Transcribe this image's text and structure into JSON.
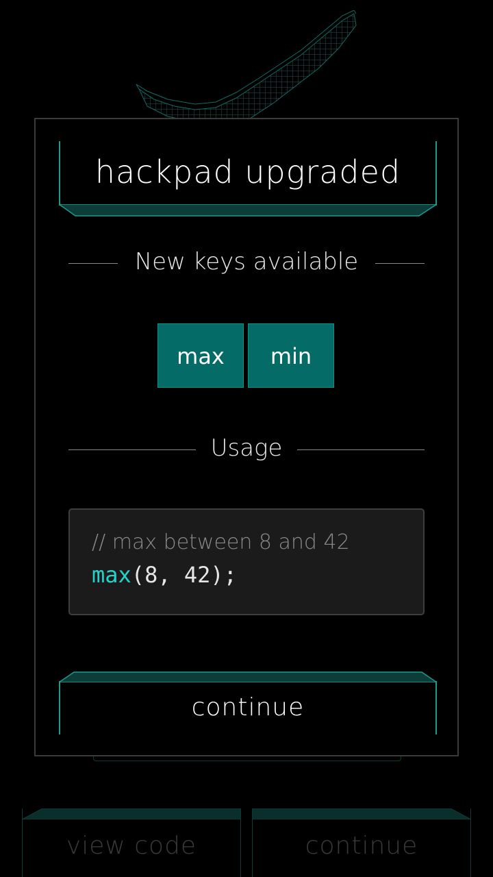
{
  "modal": {
    "title": "hackpad upgraded",
    "keys_heading": "New keys available",
    "keys": [
      "max",
      "min"
    ],
    "usage_heading": "Usage",
    "code_comment": "// max between 8 and 42",
    "code_fn": "max",
    "code_args": "(8, 42);",
    "continue_label": "continue"
  },
  "background": {
    "view_code_label": "view code",
    "continue_label": "continue"
  },
  "colors": {
    "accent": "#1f9b8e",
    "key_fill": "#056b67",
    "code_fn": "#22d3cc",
    "code_bg": "#1b1b1b"
  }
}
